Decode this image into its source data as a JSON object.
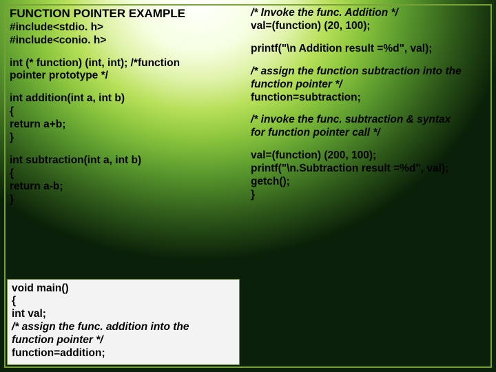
{
  "left": {
    "title": "FUNCTION POINTER EXAMPLE",
    "inc1": "#include<stdio. h>",
    "inc2": "#include<conio. h>",
    "proto": "int (* function) (int, int);  /*function",
    "proto2": "pointer prototype */",
    "add1": "int addition(int a, int b)",
    "add2": "{",
    "add3": "return a+b;",
    "add4": "}",
    "sub1": "int subtraction(int a, int b)",
    "sub2": "{",
    "sub3": "return a-b;",
    "sub4": "}",
    "main1": "void main()",
    "main2": "{",
    "main3": "int val;",
    "assign_c1": "/* assign the func. addition into the",
    "assign_c2": "function pointer */",
    "assign": "function=addition;"
  },
  "right": {
    "invoke_c": "/* Invoke the func. Addition  */",
    "invoke": "val=(function) (20, 100);",
    "printf1": "printf(\"\\n Addition result =%d\", val);",
    "assign2_c1": "/* assign the function subtraction into the",
    "assign2_c2": "function pointer */",
    "assign2": "function=subtraction;",
    "invoke2_c1": "/* invoke the func. subtraction & syntax",
    "invoke2_c2": "for function pointer call */",
    "val2": "val=(function) (200, 100);",
    "printf2": "printf(\"\\n.Subtraction result =%d\", val);",
    "getch": "getch();",
    "close": "}"
  }
}
